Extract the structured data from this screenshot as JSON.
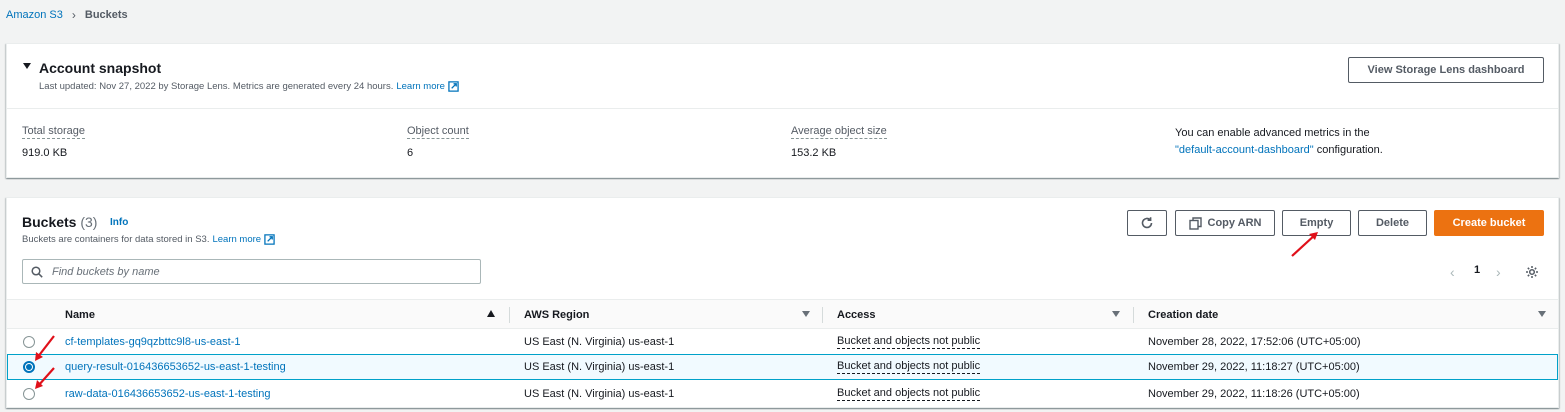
{
  "breadcrumb": {
    "root": "Amazon S3",
    "current": "Buckets"
  },
  "snapshot": {
    "title": "Account snapshot",
    "subtitle": "Last updated: Nov 27, 2022 by Storage Lens. Metrics are generated every 24 hours.",
    "learn_more": "Learn more",
    "view_button": "View Storage Lens dashboard",
    "metrics": [
      {
        "label": "Total storage",
        "value": "919.0 KB"
      },
      {
        "label": "Object count",
        "value": "6"
      },
      {
        "label": "Average object size",
        "value": "153.2 KB"
      }
    ],
    "advanced_text": "You can enable advanced metrics in the",
    "advanced_link": "\"default-account-dashboard\"",
    "advanced_suffix": "configuration."
  },
  "buckets": {
    "title": "Buckets",
    "count": "(3)",
    "info": "Info",
    "subtitle": "Buckets are containers for data stored in S3.",
    "learn_more": "Learn more",
    "actions": {
      "copy_arn": "Copy ARN",
      "empty": "Empty",
      "delete": "Delete",
      "create": "Create bucket"
    },
    "search_placeholder": "Find buckets by name",
    "page": "1",
    "columns": [
      "Name",
      "AWS Region",
      "Access",
      "Creation date"
    ],
    "rows": [
      {
        "name": "cf-templates-gq9qzbttc9l8-us-east-1",
        "region": "US East (N. Virginia) us-east-1",
        "access": "Bucket and objects not public",
        "created": "November 28, 2022, 17:52:06 (UTC+05:00)",
        "selected": false
      },
      {
        "name": "query-result-016436653652-us-east-1-testing",
        "region": "US East (N. Virginia) us-east-1",
        "access": "Bucket and objects not public",
        "created": "November 29, 2022, 11:18:27 (UTC+05:00)",
        "selected": true
      },
      {
        "name": "raw-data-016436653652-us-east-1-testing",
        "region": "US East (N. Virginia) us-east-1",
        "access": "Bucket and objects not public",
        "created": "November 29, 2022, 11:18:26 (UTC+05:00)",
        "selected": false
      }
    ]
  },
  "colors": {
    "link": "#0073bb",
    "primary": "#ec7211",
    "annotation": "#e0101a",
    "selected_border": "#00a1c9"
  },
  "icons": [
    "chevron-right-icon",
    "external-link-icon",
    "refresh-icon",
    "copy-icon",
    "search-icon",
    "chevron-left-icon",
    "settings-gear-icon",
    "sort-icon",
    "annotation-arrow-icon"
  ]
}
